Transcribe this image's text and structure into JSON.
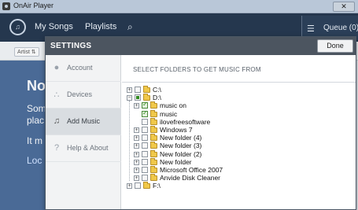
{
  "window": {
    "title": "OnAir Player",
    "close_glyph": "✕"
  },
  "appbar": {
    "logo_icon": "logo-icon",
    "nav": [
      {
        "label": "My Songs"
      },
      {
        "label": "Playlists"
      }
    ],
    "search_glyph": "⌕",
    "queue": {
      "icon_glyph": "☰",
      "label": "Queue (0)"
    }
  },
  "background": {
    "sort_label": "Artist ⇅",
    "title": "No",
    "lines": [
      "Som",
      "plac",
      "It m"
    ],
    "link": "Loc"
  },
  "settings": {
    "title": "SETTINGS",
    "done_label": "Done",
    "sidebar": [
      {
        "label": "Account",
        "icon": "●",
        "active": false
      },
      {
        "label": "Devices",
        "icon": "∴",
        "active": false
      },
      {
        "label": "Add Music",
        "icon": "♫",
        "active": true
      },
      {
        "label": "Help & About",
        "icon": "?",
        "active": false
      }
    ],
    "heading": "SELECT FOLDERS TO GET MUSIC FROM",
    "tree": [
      {
        "label": "C:\\",
        "level": 0,
        "expander": "+",
        "state": "none"
      },
      {
        "label": "D:\\",
        "level": 0,
        "expander": "−",
        "state": "partial"
      },
      {
        "label": "music on",
        "level": 1,
        "expander": "+",
        "state": "checked"
      },
      {
        "label": "music",
        "level": 1,
        "expander": "",
        "state": "checked"
      },
      {
        "label": "ilovefreesoftware",
        "level": 1,
        "expander": "",
        "state": "none"
      },
      {
        "label": "Windows 7",
        "level": 1,
        "expander": "+",
        "state": "none"
      },
      {
        "label": "New folder (4)",
        "level": 1,
        "expander": "+",
        "state": "none"
      },
      {
        "label": "New folder (3)",
        "level": 1,
        "expander": "+",
        "state": "none"
      },
      {
        "label": "New folder (2)",
        "level": 1,
        "expander": "+",
        "state": "none"
      },
      {
        "label": "New folder",
        "level": 1,
        "expander": "+",
        "state": "none"
      },
      {
        "label": "Microsoft Office 2007",
        "level": 1,
        "expander": "+",
        "state": "none"
      },
      {
        "label": "Anvide Disk Cleaner",
        "level": 1,
        "expander": "+",
        "state": "none"
      },
      {
        "label": "F:\\",
        "level": 0,
        "expander": "+",
        "state": "none"
      }
    ]
  },
  "colors": {
    "appbar": "#25374e",
    "modal_header": "#4c5560",
    "hero": "#4a6a96",
    "check": "#2f8a1f"
  }
}
